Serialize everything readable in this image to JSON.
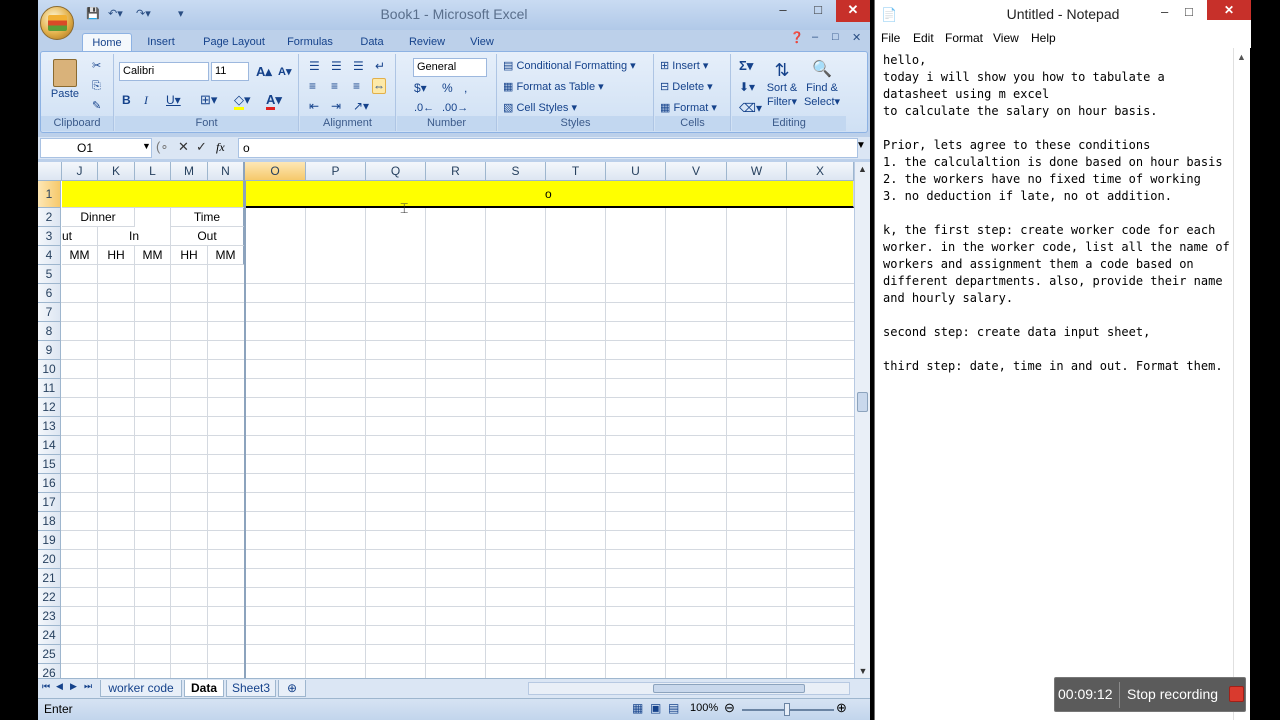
{
  "excel": {
    "title": "Book1 - Microsoft Excel",
    "tabs": [
      "Home",
      "Insert",
      "Page Layout",
      "Formulas",
      "Data",
      "Review",
      "View"
    ],
    "clipboard": {
      "paste": "Paste",
      "label": "Clipboard"
    },
    "font": {
      "name": "Calibri",
      "size": "11",
      "label": "Font"
    },
    "alignment": {
      "label": "Alignment"
    },
    "number": {
      "format": "General",
      "label": "Number"
    },
    "styles": {
      "conditional": "Conditional Formatting",
      "table": "Format as Table",
      "cell": "Cell Styles",
      "label": "Styles"
    },
    "cells": {
      "insert": "Insert",
      "delete": "Delete",
      "format": "Format",
      "label": "Cells"
    },
    "editing": {
      "sort": "Sort &",
      "filter": "Filter",
      "find": "Find &",
      "select": "Select",
      "label": "Editing"
    },
    "formula": {
      "namebox": "O1",
      "fx": "fx",
      "value": "o"
    },
    "columns": [
      "J",
      "K",
      "L",
      "M",
      "N",
      "O",
      "P",
      "Q",
      "R",
      "S",
      "T",
      "U",
      "V",
      "W",
      "X"
    ],
    "rows": [
      "1",
      "2",
      "3",
      "4",
      "5",
      "6",
      "7",
      "8",
      "9",
      "10",
      "11",
      "12",
      "13",
      "14",
      "15",
      "16",
      "17",
      "18",
      "19",
      "20",
      "21",
      "22",
      "23",
      "24",
      "25",
      "26"
    ],
    "cells_content": {
      "o1": "o",
      "dinner": "Dinner",
      "time": "Time",
      "ut": "ut",
      "in": "In",
      "out": "Out",
      "mm1": "MM",
      "hh1": "HH",
      "mm2": "MM",
      "hh2": "HH",
      "mm3": "MM"
    },
    "sheets": [
      "worker code",
      "Data",
      "Sheet3"
    ],
    "status": {
      "mode": "Enter",
      "zoom": "100%"
    },
    "colors": {
      "highlight": "#ffff00",
      "ribbon": "#cfe0f4"
    }
  },
  "notepad": {
    "title": "Untitled - Notepad",
    "menu": [
      "File",
      "Edit",
      "Format",
      "View",
      "Help"
    ],
    "text": "hello,\ntoday i will show you how to tabulate a datasheet using m excel\nto calculate the salary on hour basis.\n\nPrior, lets agree to these conditions\n1. the calculaltion is done based on hour basis\n2. the workers have no fixed time of working\n3. no deduction if late, no ot addition.\n\nk, the first step: create worker code for each worker. in the worker code, list all the name of workers and assignment them a code based on different departments. also, provide their name and hourly salary.\n\nsecond step: create data input sheet,\n\nthird step: date, time in and out. Format them."
  },
  "recorder": {
    "time": "00:09:12",
    "stop": "Stop recording"
  }
}
